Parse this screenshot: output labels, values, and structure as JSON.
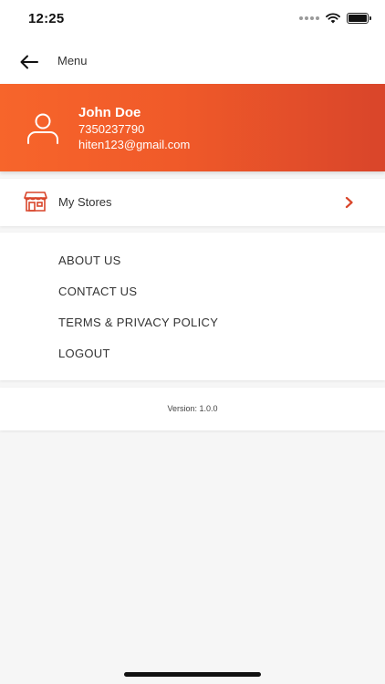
{
  "status_bar": {
    "time": "12:25"
  },
  "nav": {
    "title": "Menu",
    "back_icon": "arrow-left-icon"
  },
  "profile": {
    "name": "John Doe",
    "phone": "7350237790",
    "email": "hiten123@gmail.com",
    "avatar_icon": "user-outline-icon"
  },
  "stores": {
    "label": "My Stores",
    "icon": "storefront-icon",
    "chevron_icon": "chevron-right-icon"
  },
  "menu": {
    "items": [
      {
        "label": "ABOUT US"
      },
      {
        "label": "CONTACT US"
      },
      {
        "label": "TERMS & PRIVACY POLICY"
      },
      {
        "label": "LOGOUT"
      }
    ]
  },
  "footer": {
    "version": "Version: 1.0.0"
  },
  "colors": {
    "accent": "#f05a29",
    "accent_dark": "#d9452a",
    "background": "#f6f6f6",
    "card": "#ffffff"
  }
}
